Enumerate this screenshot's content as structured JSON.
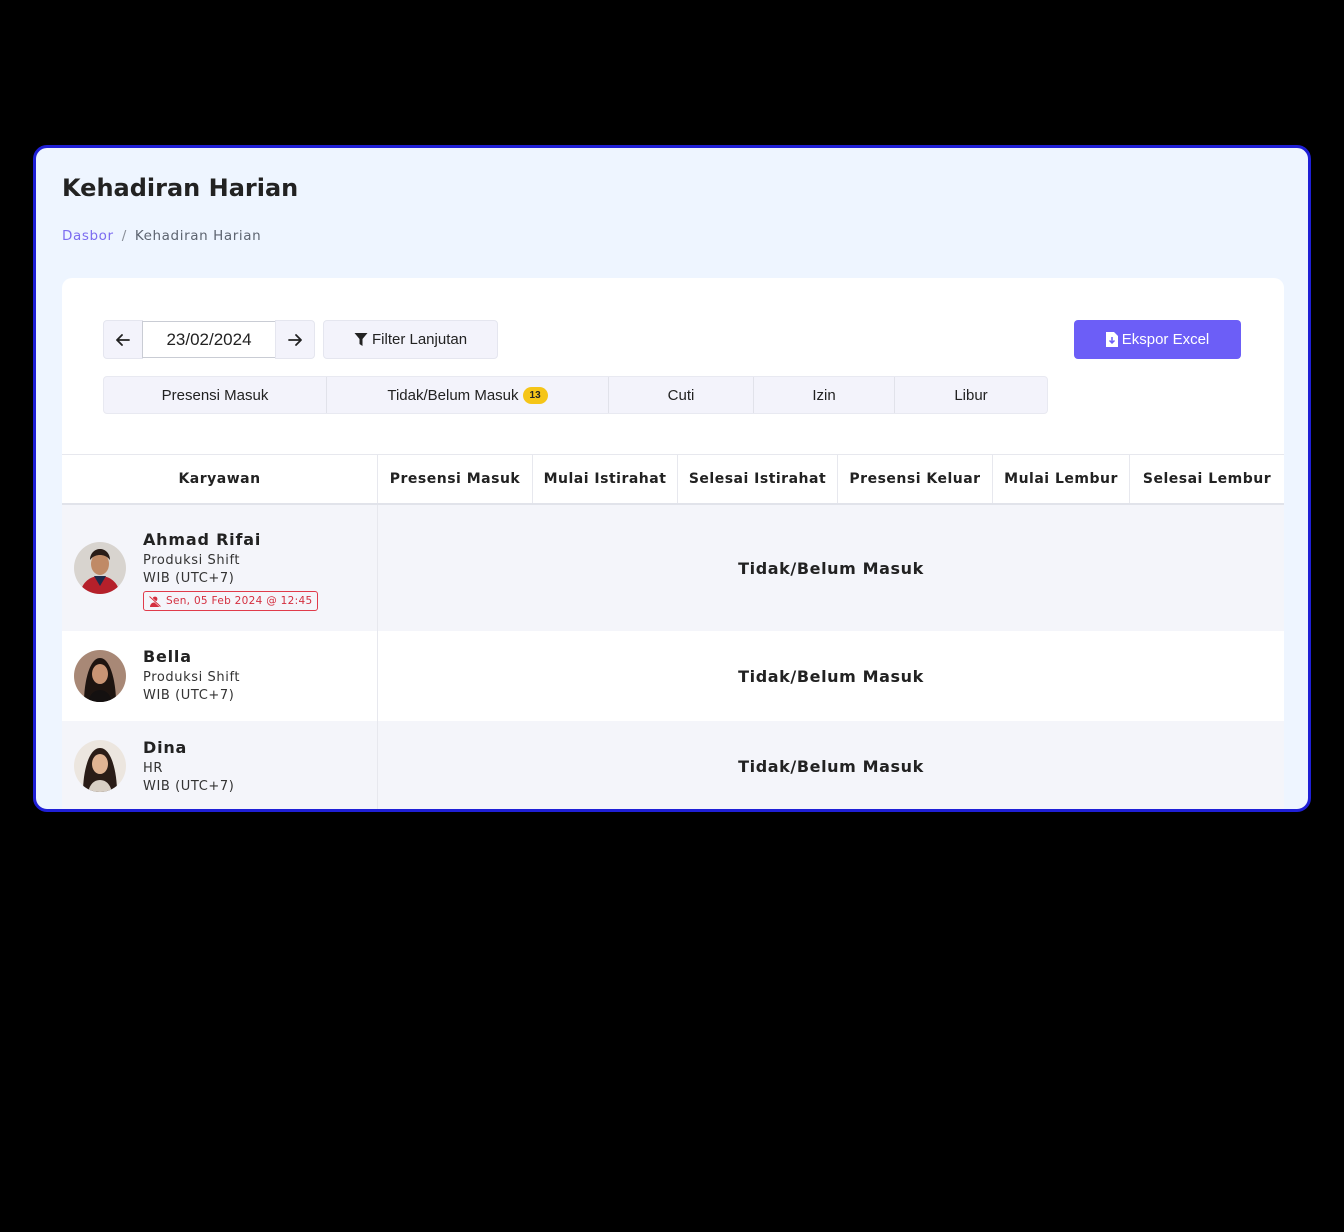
{
  "page": {
    "title": "Kehadiran Harian"
  },
  "breadcrumb": {
    "home": "Dasbor",
    "separator": "/",
    "current": "Kehadiran Harian"
  },
  "toolbar": {
    "date_value": "23/02/2024",
    "filter_label": "Filter Lanjutan",
    "export_label": "Ekspor Excel"
  },
  "tabs": [
    {
      "label": "Presensi Masuk"
    },
    {
      "label": "Tidak/Belum Masuk",
      "badge": "13"
    },
    {
      "label": "Cuti"
    },
    {
      "label": "Izin"
    },
    {
      "label": "Libur"
    }
  ],
  "table": {
    "columns": [
      "Karyawan",
      "Presensi Masuk",
      "Mulai Istirahat",
      "Selesai Istirahat",
      "Presensi Keluar",
      "Mulai Lembur",
      "Selesai Lembur"
    ],
    "rows": [
      {
        "name": "Ahmad Rifai",
        "department": "Produksi Shift",
        "timezone": "WIB (UTC+7)",
        "alert": "Sen, 05 Feb 2024 @ 12:45",
        "status": "Tidak/Belum Masuk"
      },
      {
        "name": "Bella",
        "department": "Produksi Shift",
        "timezone": "WIB (UTC+7)",
        "status": "Tidak/Belum Masuk"
      },
      {
        "name": "Dina",
        "department": "HR",
        "timezone": "WIB (UTC+7)",
        "status": "Tidak/Belum Masuk"
      }
    ]
  },
  "colors": {
    "accent": "#6c5ef7",
    "badge": "#f5c518",
    "alert": "#d42f3f",
    "frame_border": "#1f1fd6"
  }
}
